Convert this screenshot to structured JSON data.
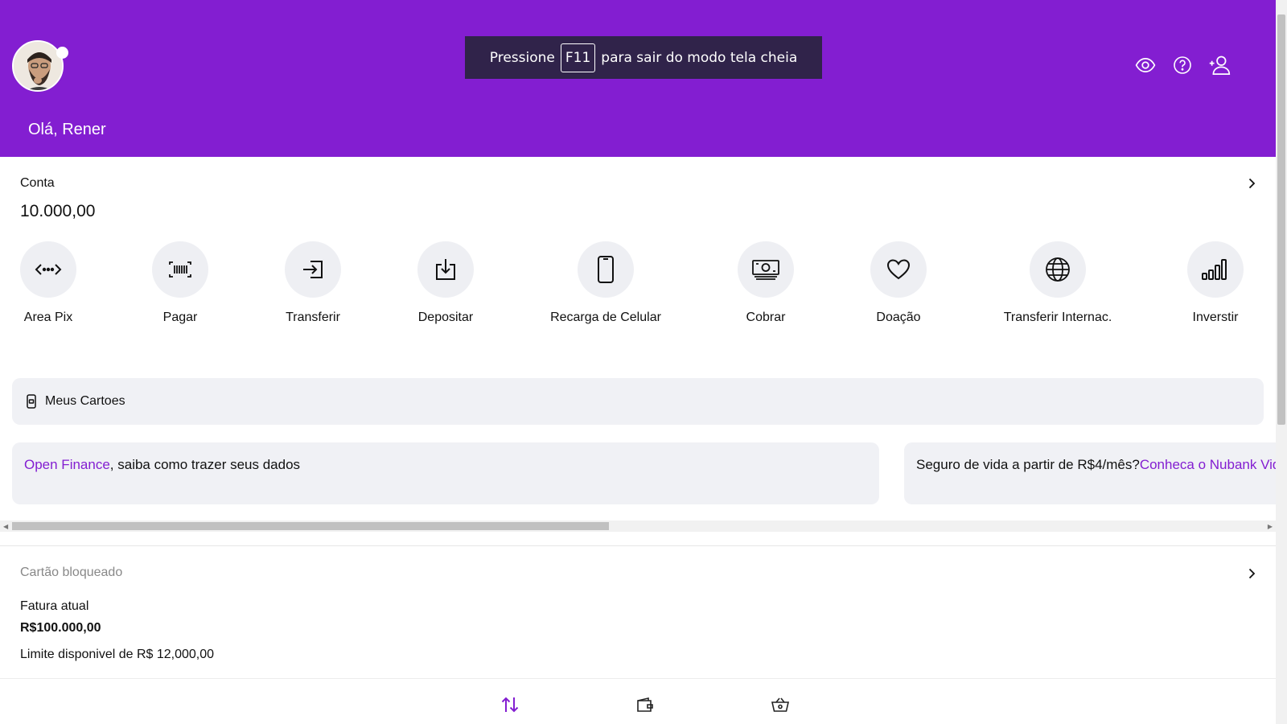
{
  "header": {
    "greeting": "Olá, Rener",
    "icons": [
      "eye-icon",
      "help-icon",
      "add-user-icon"
    ],
    "background": "#831ed1"
  },
  "fullscreen_toast": {
    "before": "Pressione",
    "key": "F11",
    "after": "para sair do modo tela cheia"
  },
  "account": {
    "title": "Conta",
    "balance": "10.000,00"
  },
  "actions": [
    {
      "label": "Area Pix",
      "icon": "pix-icon"
    },
    {
      "label": "Pagar",
      "icon": "barcode-icon"
    },
    {
      "label": "Transferir",
      "icon": "transfer-icon"
    },
    {
      "label": "Depositar",
      "icon": "deposit-icon"
    },
    {
      "label": "Recarga de Celular",
      "icon": "phone-icon"
    },
    {
      "label": "Cobrar",
      "icon": "money-icon"
    },
    {
      "label": "Doação",
      "icon": "heart-icon"
    },
    {
      "label": "Transferir Internac.",
      "icon": "globe-icon"
    },
    {
      "label": "Inverstir",
      "icon": "bars-icon"
    }
  ],
  "cards_button": {
    "label": "Meus Cartoes",
    "icon": "card-phone-icon"
  },
  "promos": [
    {
      "highlight": "Open Finance",
      "text": ", saiba como trazer seus dados"
    },
    {
      "text": "Seguro de vida a partir de R$4/mês?",
      "highlight": "Conheca o Nubank Vida"
    }
  ],
  "credit_card": {
    "status": "Cartão bloqueado",
    "invoice_label": "Fatura atual",
    "invoice_value": "R$100.000,00",
    "limit": "Limite disponivel de R$ 12,000,00"
  },
  "bottom_nav": {
    "items": [
      "transfer-arrows-icon",
      "wallet-icon",
      "shopping-basket-icon"
    ],
    "active_color": "#831ed1"
  }
}
